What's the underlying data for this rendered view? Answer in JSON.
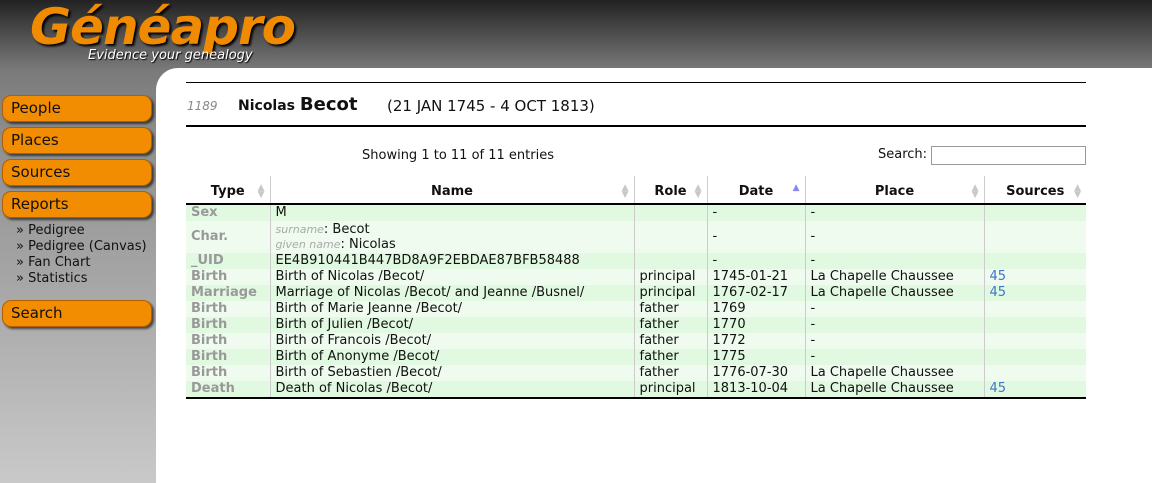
{
  "brand": {
    "logo": "Généapro",
    "tagline": "Evidence your genealogy"
  },
  "nav": {
    "people": "People",
    "places": "Places",
    "sources": "Sources",
    "reports": "Reports",
    "search": "Search",
    "reports_sub": [
      "» Pedigree",
      "» Pedigree (Canvas)",
      "» Fan Chart",
      "» Statistics"
    ]
  },
  "person": {
    "id": "1189",
    "given": "Nicolas",
    "surname": "Becot",
    "dates": "(21 JAN 1745 - 4 OCT 1813)"
  },
  "table": {
    "info": "Showing 1 to 11 of 11 entries",
    "search_label": "Search:",
    "search_value": "",
    "headers": [
      "Type",
      "Name",
      "Role",
      "Date",
      "Place",
      "Sources"
    ],
    "char_labels": {
      "surname": "surname",
      "given": "given name"
    },
    "char_values": {
      "surname": ": Becot",
      "given": ": Nicolas"
    },
    "rows": [
      {
        "type": "Sex",
        "name": "M",
        "role": "",
        "date": "-",
        "place": "-",
        "source": ""
      },
      {
        "type": "Char.",
        "name": "",
        "role": "",
        "date": "-",
        "place": "-",
        "source": ""
      },
      {
        "type": "_UID",
        "name": "EE4B910441B447BD8A9F2EBDAE87BFB58488",
        "role": "",
        "date": "-",
        "place": "-",
        "source": ""
      },
      {
        "type": "Birth",
        "name": "Birth of Nicolas /Becot/",
        "role": "principal",
        "date": "1745-01-21",
        "place": "La Chapelle Chaussee",
        "source": "45"
      },
      {
        "type": "Marriage",
        "name": "Marriage of Nicolas /Becot/ and Jeanne /Busnel/",
        "role": "principal",
        "date": "1767-02-17",
        "place": "La Chapelle Chaussee",
        "source": "45"
      },
      {
        "type": "Birth",
        "name": "Birth of Marie Jeanne /Becot/",
        "role": "father",
        "date": "1769",
        "place": "-",
        "source": ""
      },
      {
        "type": "Birth",
        "name": "Birth of Julien /Becot/",
        "role": "father",
        "date": "1770",
        "place": "-",
        "source": ""
      },
      {
        "type": "Birth",
        "name": "Birth of Francois /Becot/",
        "role": "father",
        "date": "1772",
        "place": "-",
        "source": ""
      },
      {
        "type": "Birth",
        "name": "Birth of Anonyme /Becot/",
        "role": "father",
        "date": "1775",
        "place": "-",
        "source": ""
      },
      {
        "type": "Birth",
        "name": "Birth of Sebastien /Becot/",
        "role": "father",
        "date": "1776-07-30",
        "place": "La Chapelle Chaussee",
        "source": ""
      },
      {
        "type": "Death",
        "name": "Death of Nicolas /Becot/",
        "role": "principal",
        "date": "1813-10-04",
        "place": "La Chapelle Chaussee",
        "source": "45"
      }
    ]
  }
}
